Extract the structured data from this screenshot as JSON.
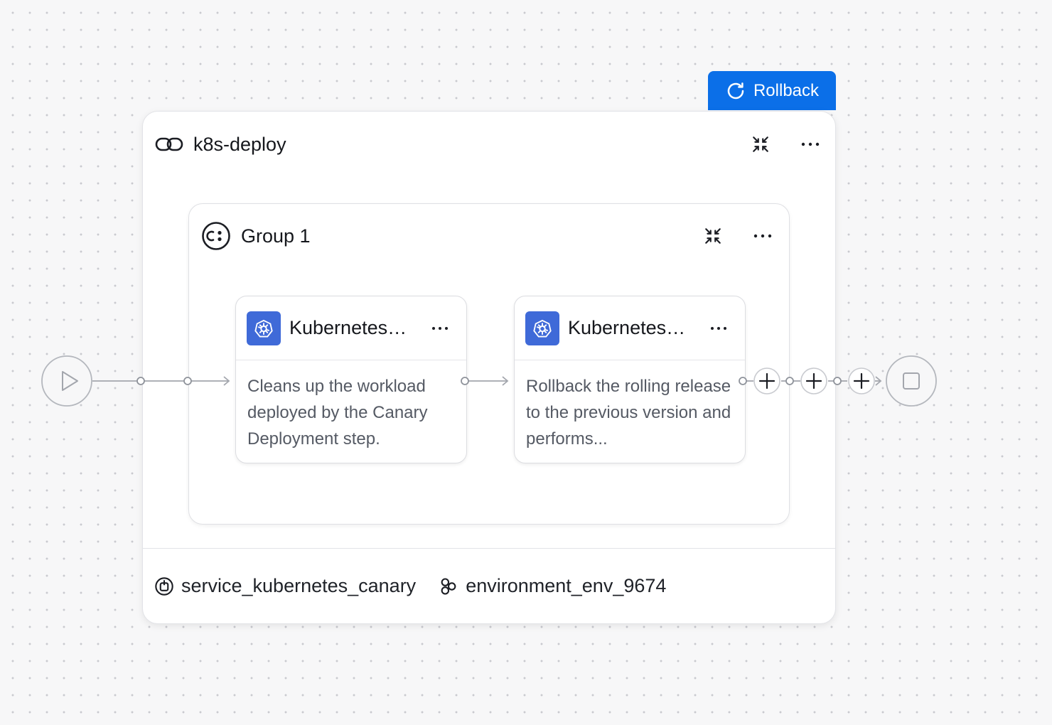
{
  "actions": {
    "rollback_label": "Rollback"
  },
  "stage": {
    "title": "k8s-deploy",
    "icon": "infinity-link-icon",
    "service": "service_kubernetes_canary",
    "environment": "environment_env_9674"
  },
  "group": {
    "title": "Group 1"
  },
  "steps": [
    {
      "title": "Kubernetes Canary Delete",
      "description": "Cleans up the workload deployed by the Canary Deployment step."
    },
    {
      "title": "Kubernetes Rollback",
      "description": "Rollback the rolling release to the previous version and performs..."
    }
  ],
  "colors": {
    "accent": "#0b6fe8",
    "k8s": "#3f6ad8",
    "connector": "#a3a6ad"
  }
}
